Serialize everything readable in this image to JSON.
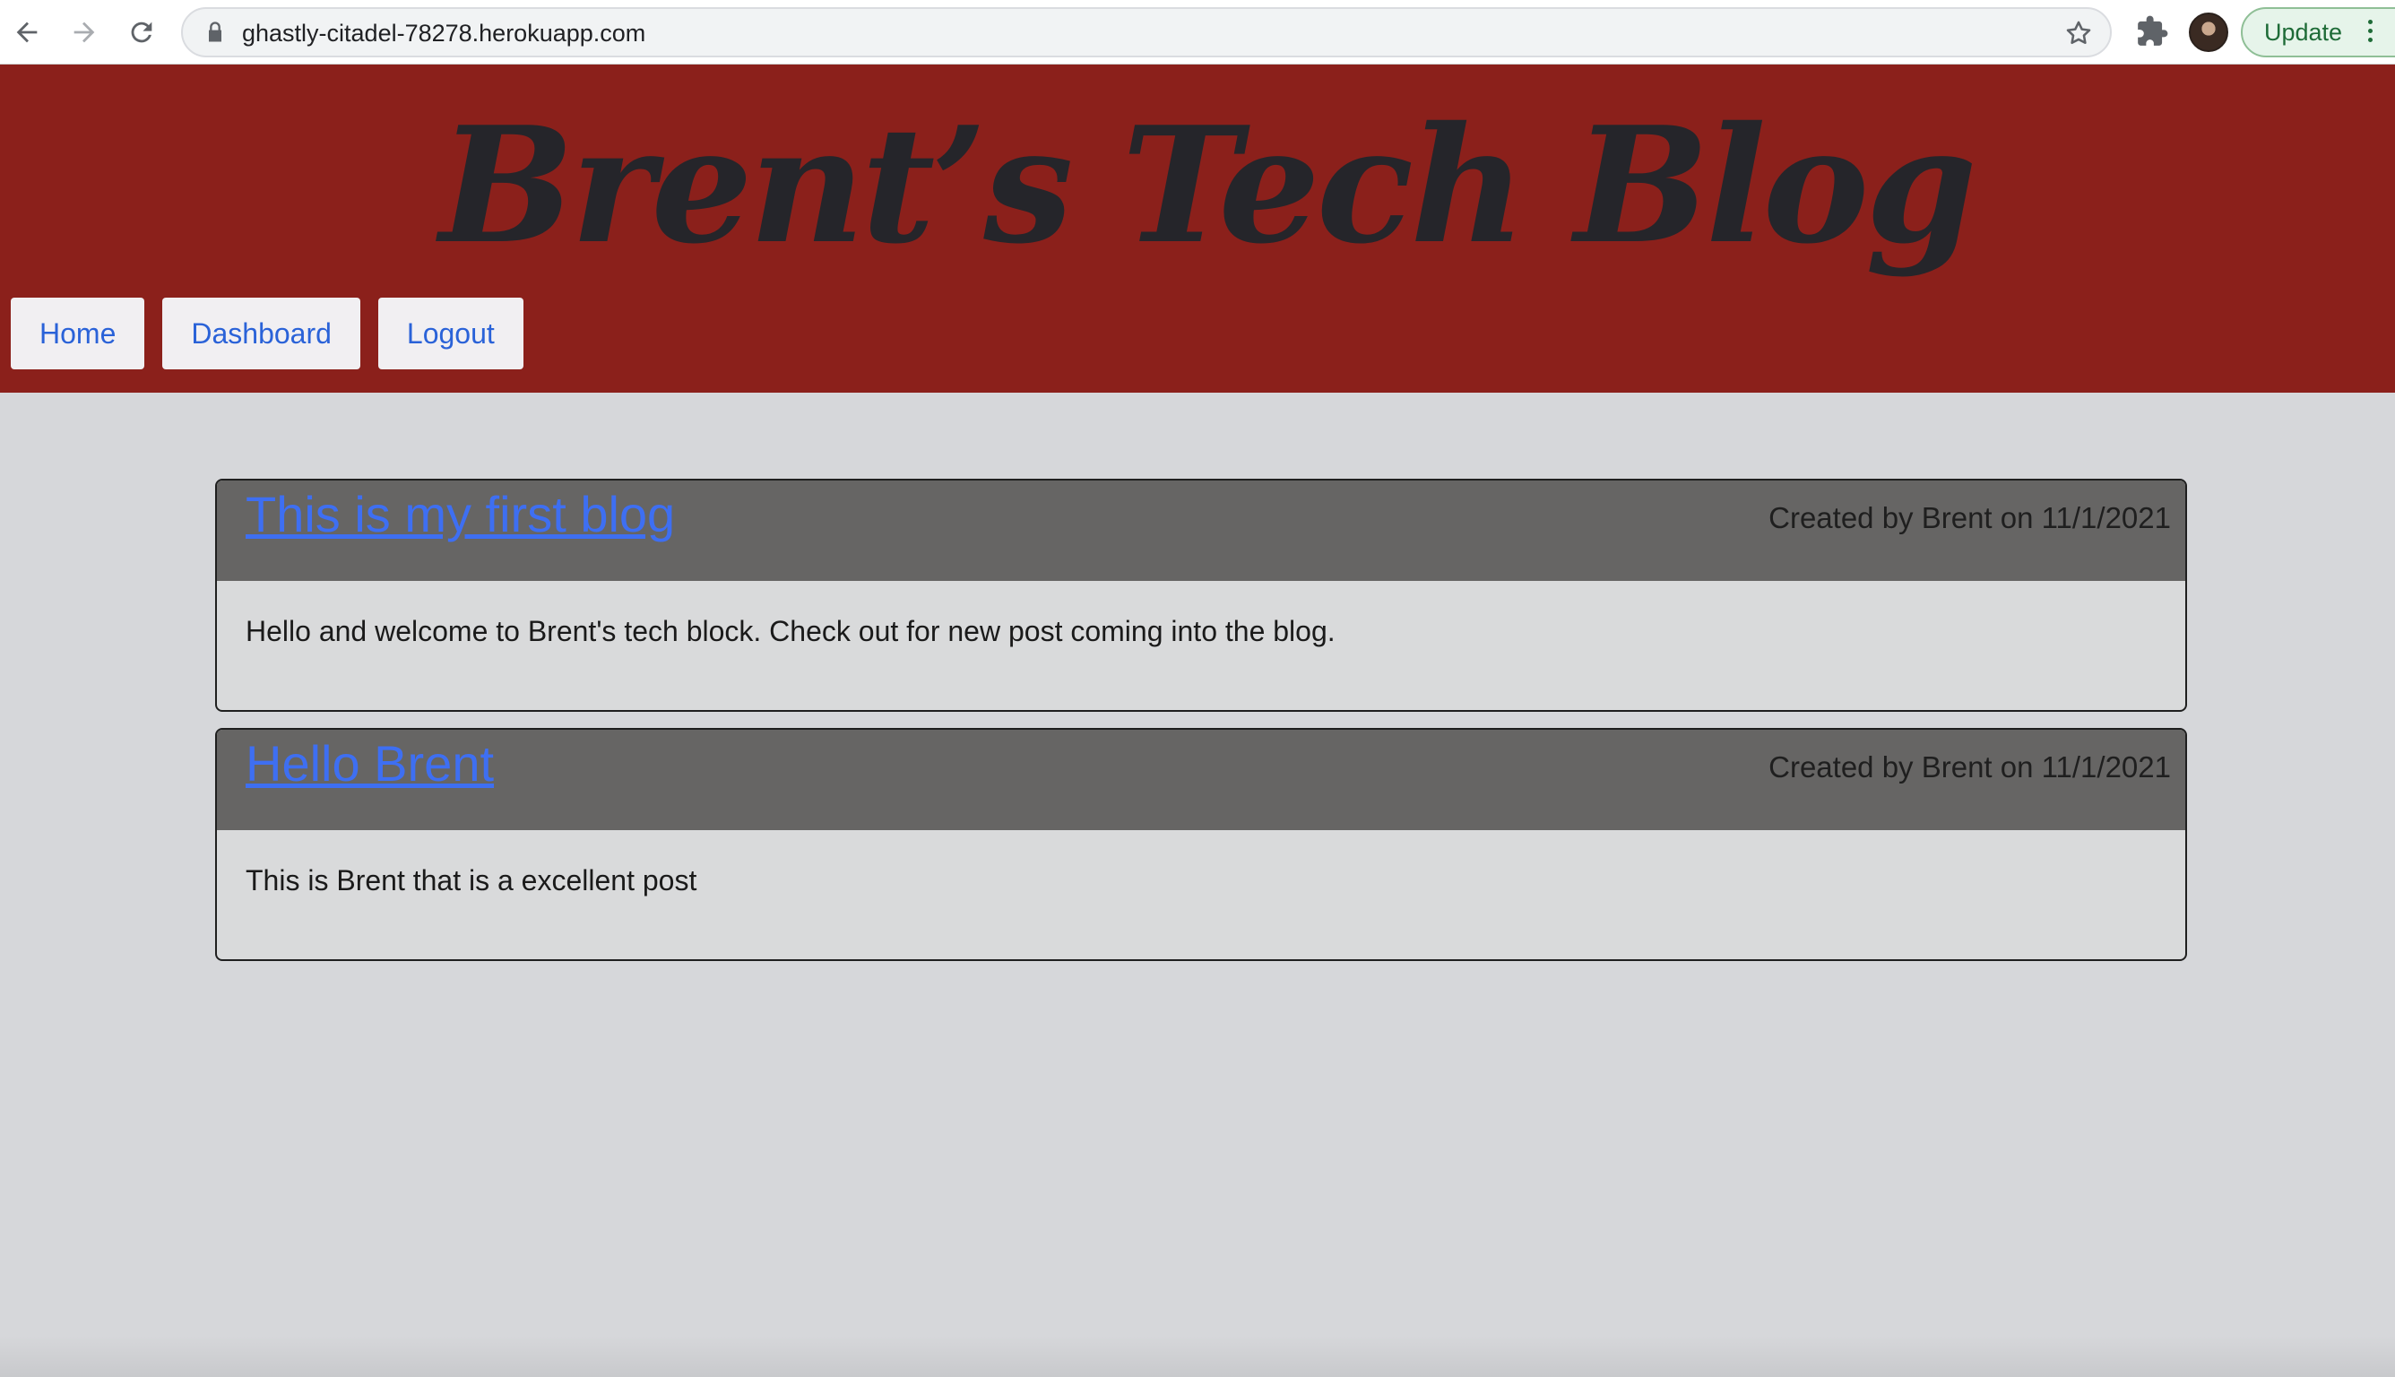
{
  "browser": {
    "url": "ghastly-citadel-78278.herokuapp.com",
    "update_label": "Update",
    "icons": [
      "back-arrow-icon",
      "forward-arrow-icon",
      "reload-icon",
      "lock-icon",
      "star-icon",
      "extensions-icon",
      "kebab-menu-icon"
    ]
  },
  "header": {
    "title": "Brent’s Tech Blog",
    "nav": [
      {
        "label": "Home"
      },
      {
        "label": "Dashboard"
      },
      {
        "label": "Logout"
      }
    ]
  },
  "posts": [
    {
      "title": "This is my first blog",
      "meta": "Created by Brent on 11/1/2021",
      "body": "Hello and welcome to Brent's tech block. Check out for new post coming into the blog."
    },
    {
      "title": "Hello Brent",
      "meta": "Created by Brent on 11/1/2021",
      "body": "This is Brent that is a excellent post"
    }
  ],
  "colors": {
    "header_bg": "#8b201b",
    "page_bg": "#d6d7da",
    "post_head_bg": "#666564",
    "link": "#3e6ff2",
    "nav_link": "#2a62d8"
  }
}
